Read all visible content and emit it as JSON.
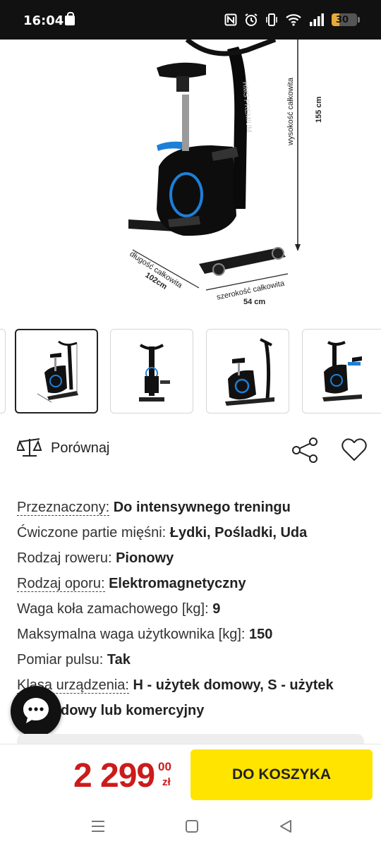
{
  "status_bar": {
    "time": "16:04",
    "battery": "30",
    "battery_level_percent": 30,
    "icons": [
      "shopping-bag-icon",
      "nfc-icon",
      "alarm-icon",
      "vibrate-icon",
      "wifi-icon",
      "signal-icon",
      "battery-icon"
    ]
  },
  "product_image": {
    "height_label": "wysokość całkowita",
    "height_value": "155 cm",
    "length_label": "długość całkowita",
    "length_value": "102cm",
    "width_label": "szerokość całkowita",
    "width_value": "54 cm",
    "frame_text": "HMS PREMIUM"
  },
  "thumbnails": {
    "count_visible": 4,
    "active_index": 0
  },
  "actions": {
    "compare_label": "Porównaj",
    "share_icon": "share-icon",
    "favorite_icon": "heart-icon"
  },
  "specs": [
    {
      "label": "Przeznaczony:",
      "value": "Do intensywnego treningu",
      "underlined": true
    },
    {
      "label": "Ćwiczone partie mięśni:",
      "value": "Łydki, Pośladki, Uda",
      "underlined": false
    },
    {
      "label": "Rodzaj roweru:",
      "value": "Pionowy",
      "underlined": false
    },
    {
      "label": "Rodzaj oporu:",
      "value": "Elektromagnetyczny",
      "underlined": true
    },
    {
      "label": "Waga koła zamachowego [kg]:",
      "value": "9",
      "underlined": false
    },
    {
      "label": "Maksymalna waga użytkownika [kg]:",
      "value": "150",
      "underlined": false
    },
    {
      "label": "Pomiar pulsu:",
      "value": "Tak",
      "underlined": false
    },
    {
      "label": "Klasa urządzenia:",
      "value": "H - użytek domowy, S - użytek",
      "underlined": true
    },
    {
      "label": "",
      "value": "dowy lub komercyjny",
      "underlined": false
    }
  ],
  "buy": {
    "price_main": "2 299",
    "price_cents": "00",
    "currency": "zł",
    "cart_label": "DO KOSZYKA"
  },
  "colors": {
    "price": "#cc1b1b",
    "cart_button": "#ffe400",
    "accent_blue": "#1e7fd6"
  }
}
